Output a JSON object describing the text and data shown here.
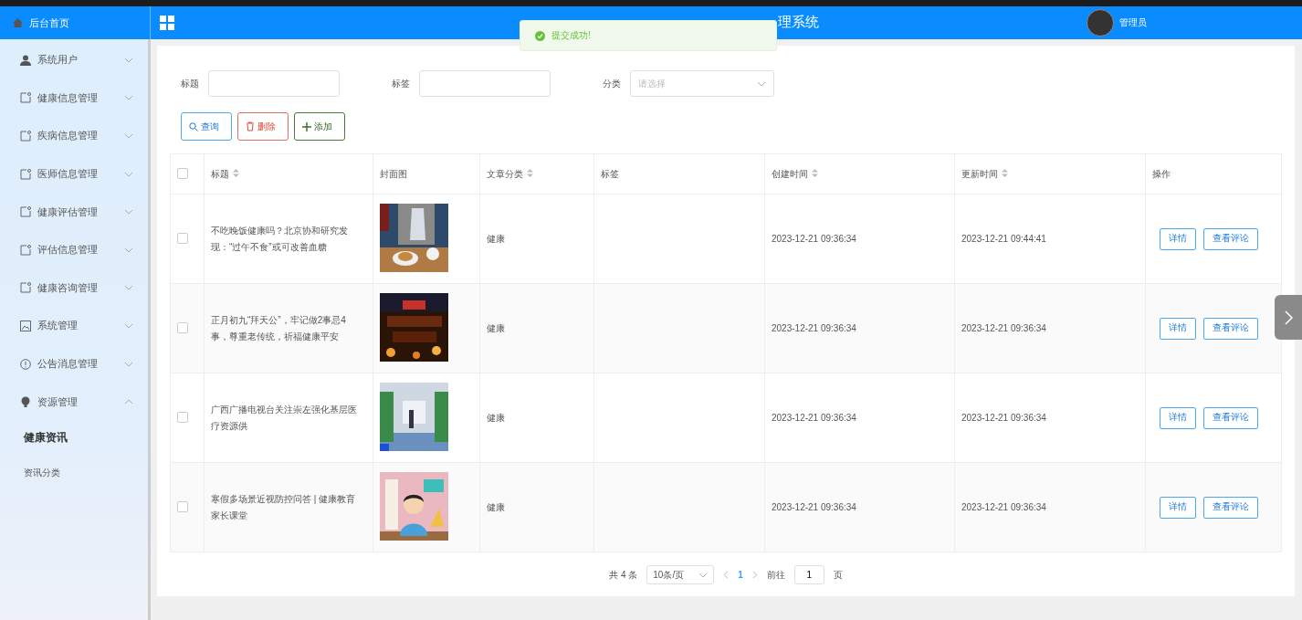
{
  "sidebar": {
    "home": "后台首页",
    "items": [
      {
        "label": "系统用户",
        "expanded": false
      },
      {
        "label": "健康信息管理",
        "expanded": false
      },
      {
        "label": "疾病信息管理",
        "expanded": false
      },
      {
        "label": "医师信息管理",
        "expanded": false
      },
      {
        "label": "健康评估管理",
        "expanded": false
      },
      {
        "label": "评估信息管理",
        "expanded": false
      },
      {
        "label": "健康咨询管理",
        "expanded": false
      },
      {
        "label": "系统管理",
        "expanded": false
      },
      {
        "label": "公告消息管理",
        "expanded": false
      },
      {
        "label": "资源管理",
        "expanded": true,
        "children": [
          {
            "label": "健康资讯",
            "selected": true
          },
          {
            "label": "资讯分类",
            "selected": false
          }
        ]
      }
    ]
  },
  "header": {
    "title": "理系统",
    "user": "管理员"
  },
  "toast": {
    "message": "提交成功!"
  },
  "filters": [
    {
      "label": "标题",
      "kind": "text"
    },
    {
      "label": "标签",
      "kind": "text"
    },
    {
      "label": "分类",
      "kind": "select",
      "placeholder": "请选择"
    }
  ],
  "actions": [
    {
      "label": "查询",
      "kind": "search"
    },
    {
      "label": "删除",
      "kind": "delete"
    },
    {
      "label": "添加",
      "kind": "add"
    }
  ],
  "table": {
    "all_checked": false,
    "columns": [
      {
        "label": "标题",
        "sortable": true
      },
      {
        "label": "封面图",
        "sortable": false
      },
      {
        "label": "文章分类",
        "sortable": true
      },
      {
        "label": "标签",
        "sortable": false
      },
      {
        "label": "创建时间",
        "sortable": true
      },
      {
        "label": "更新时间",
        "sortable": true
      },
      {
        "label": "操作",
        "sortable": false
      }
    ],
    "rows": [
      {
        "checked": false,
        "title": "不吃晚饭健康吗？北京协和研究发现：“过午不食”或可改善血糖",
        "category": "健康",
        "created": "2023-12-21 09:36:34",
        "updated": "2023-12-21 09:44:41",
        "buttons": [
          "详情",
          "查看评论"
        ]
      },
      {
        "checked": false,
        "title": "正月初九“拜天公”，牢记做2事忌4事，尊重老传统，祈福健康平安",
        "category": "健康",
        "created": "2023-12-21 09:36:34",
        "updated": "2023-12-21 09:36:34",
        "buttons": [
          "详情",
          "查看评论"
        ]
      },
      {
        "checked": false,
        "title": "广西广播电视台关注崇左强化基层医疗资源供",
        "category": "健康",
        "created": "2023-12-21 09:36:34",
        "updated": "2023-12-21 09:36:34",
        "buttons": [
          "详情",
          "查看评论"
        ]
      },
      {
        "checked": false,
        "title": "寒假多场景近视防控问答 | 健康教育家长课堂",
        "category": "健康",
        "created": "2023-12-21 09:36:34",
        "updated": "2023-12-21 09:36:34",
        "buttons": [
          "详情",
          "查看评论"
        ]
      }
    ]
  },
  "pagination": {
    "total": "共 4 条",
    "page_size": "10条/页",
    "pages": [
      {
        "label": "1",
        "selected": true
      }
    ],
    "goto": "前往",
    "goto_value": "1",
    "suffix": "页"
  }
}
